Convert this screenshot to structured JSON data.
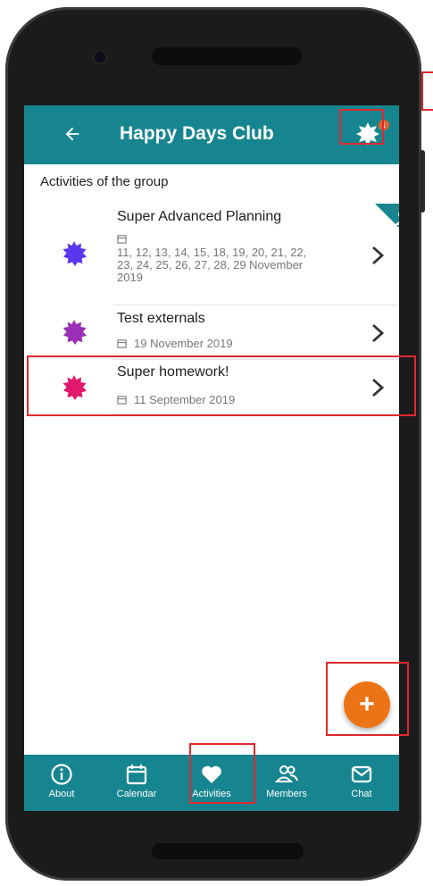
{
  "app": {
    "title": "Happy Days Club",
    "notification_count": "1"
  },
  "section_label": "Activities of the group",
  "activities": [
    {
      "title": "Super Advanced Planning",
      "date": "11, 12, 13, 14, 15, 18, 19, 20, 21, 22,\n23, 24, 25, 26, 27, 28, 29 November\n2019",
      "color": "#5b36f0"
    },
    {
      "title": "Test externals",
      "date": "19 November 2019",
      "color": "#9b2fb5"
    },
    {
      "title": "Super homework!",
      "date": "11 September 2019",
      "color": "#e2186c"
    }
  ],
  "bottom_nav": [
    {
      "label": "About",
      "icon": "info-icon"
    },
    {
      "label": "Calendar",
      "icon": "calendar-icon"
    },
    {
      "label": "Activities",
      "icon": "heart-icon"
    },
    {
      "label": "Members",
      "icon": "members-icon"
    },
    {
      "label": "Chat",
      "icon": "chat-icon"
    }
  ],
  "colors": {
    "primary": "#17858f",
    "fab": "#ec7414",
    "highlight": "#e0282e"
  }
}
